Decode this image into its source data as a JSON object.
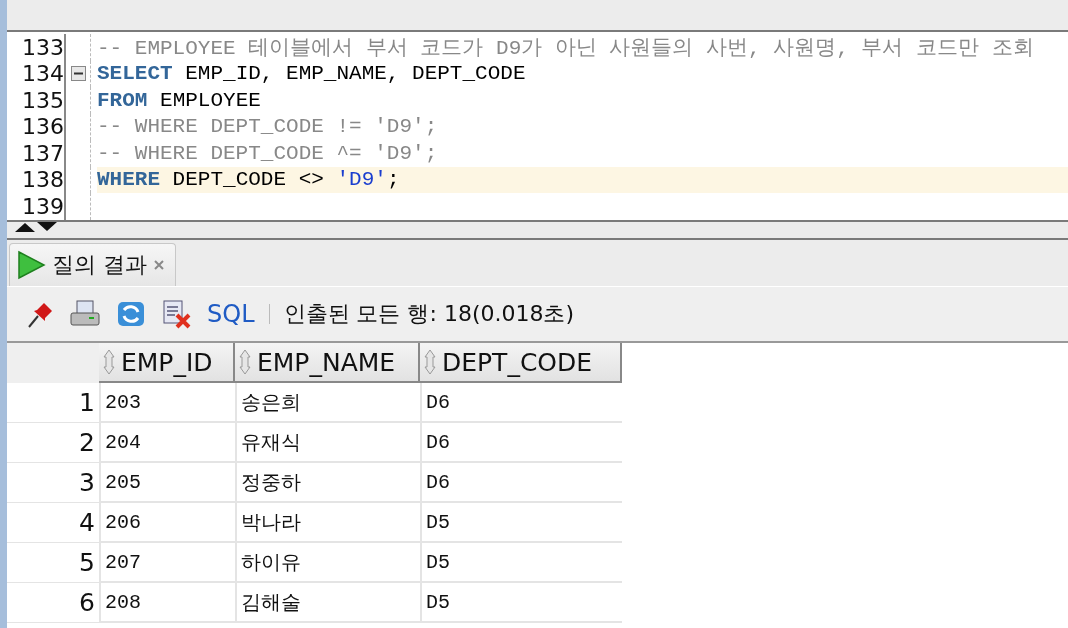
{
  "editor": {
    "lines": [
      {
        "number": "133",
        "foldable": false,
        "current": false,
        "tokens": [
          {
            "kind": "comment",
            "text": "-- EMPLOYEE 테이블에서 부서 코드가 D9가 아닌 사원들의 사번, 사원명, 부서 코드만 조회"
          }
        ]
      },
      {
        "number": "134",
        "foldable": true,
        "current": false,
        "tokens": [
          {
            "kind": "keyword",
            "text": "SELECT"
          },
          {
            "kind": "plain",
            "text": " EMP_ID, EMP_NAME, DEPT_CODE"
          }
        ]
      },
      {
        "number": "135",
        "foldable": false,
        "current": false,
        "tokens": [
          {
            "kind": "keyword",
            "text": "FROM"
          },
          {
            "kind": "plain",
            "text": " EMPLOYEE"
          }
        ]
      },
      {
        "number": "136",
        "foldable": false,
        "current": false,
        "tokens": [
          {
            "kind": "comment",
            "text": "-- WHERE DEPT_CODE != 'D9';"
          }
        ]
      },
      {
        "number": "137",
        "foldable": false,
        "current": false,
        "tokens": [
          {
            "kind": "comment",
            "text": "-- WHERE DEPT_CODE ^= 'D9';"
          }
        ]
      },
      {
        "number": "138",
        "foldable": false,
        "current": true,
        "tokens": [
          {
            "kind": "keyword",
            "text": "WHERE"
          },
          {
            "kind": "plain",
            "text": " DEPT_CODE <> "
          },
          {
            "kind": "string",
            "text": "'D9'"
          },
          {
            "kind": "plain",
            "text": ";"
          }
        ]
      },
      {
        "number": "139",
        "foldable": false,
        "current": false
      }
    ]
  },
  "results": {
    "tabs": [
      {
        "label": "질의 결과",
        "selected": true
      }
    ],
    "toolbar": {
      "sql_link": "SQL",
      "status": "인출된 모든 행: 18(0.018초)"
    },
    "table": {
      "columns": [
        "EMP_ID",
        "EMP_NAME",
        "DEPT_CODE"
      ],
      "rows": [
        {
          "number": "1",
          "cells": [
            "203",
            "송은희",
            "D6"
          ]
        },
        {
          "number": "2",
          "cells": [
            "204",
            "유재식",
            "D6"
          ]
        },
        {
          "number": "3",
          "cells": [
            "205",
            "정중하",
            "D6"
          ]
        },
        {
          "number": "4",
          "cells": [
            "206",
            "박나라",
            "D5"
          ]
        },
        {
          "number": "5",
          "cells": [
            "207",
            "하이유",
            "D5"
          ]
        },
        {
          "number": "6",
          "cells": [
            "208",
            "김해술",
            "D5"
          ]
        }
      ]
    }
  }
}
